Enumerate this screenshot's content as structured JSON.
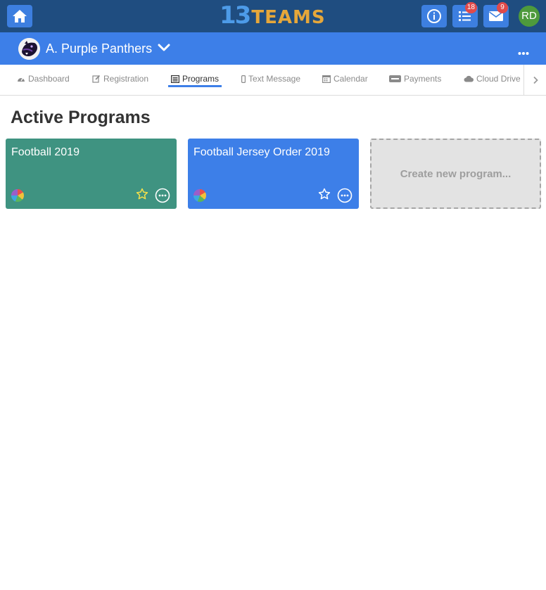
{
  "app": {
    "logo_num": "13",
    "logo_word": "TEAMS"
  },
  "topbar": {
    "tasks_badge": "18",
    "mail_badge": "9",
    "user_initials": "RD"
  },
  "team": {
    "name": "A. Purple Panthers"
  },
  "tabs": [
    {
      "label": "Dashboard",
      "icon": "dashboard-icon"
    },
    {
      "label": "Registration",
      "icon": "edit-icon"
    },
    {
      "label": "Programs",
      "icon": "list-alt-icon",
      "active": true
    },
    {
      "label": "Text Message",
      "icon": "mobile-icon"
    },
    {
      "label": "Calendar",
      "icon": "calendar-icon"
    },
    {
      "label": "Payments",
      "icon": "stripe-icon"
    },
    {
      "label": "Cloud Drive",
      "icon": "cloud-icon"
    }
  ],
  "main": {
    "title": "Active Programs",
    "programs": [
      {
        "title": "Football 2019",
        "color": "#3f9381"
      },
      {
        "title": "Football Jersey Order 2019",
        "color": "#3d7fe8"
      }
    ],
    "create_label": "Create new program..."
  },
  "colors": {
    "topbar": "#1f4d80",
    "teambar": "#3d7fe8",
    "accent": "#3d7fe8",
    "badge": "#e04a4a",
    "avatar": "#4e9a3c"
  }
}
